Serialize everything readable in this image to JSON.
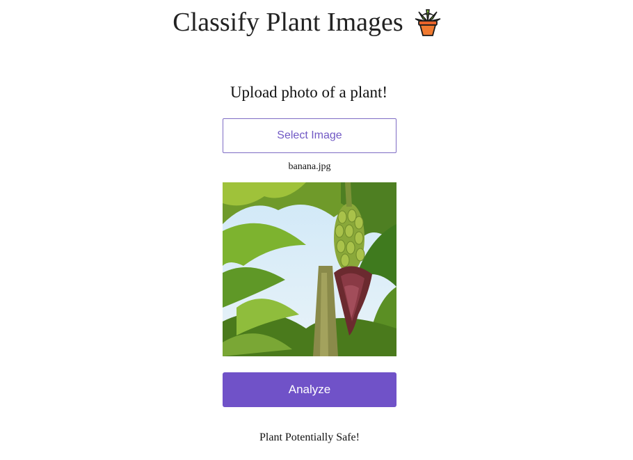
{
  "header": {
    "title": "Classify Plant Images",
    "icon": "potted-palm-icon"
  },
  "upload": {
    "prompt": "Upload photo of a plant!",
    "select_label": "Select Image",
    "file_name": "banana.jpg",
    "preview_image": "banana-plant-photo"
  },
  "actions": {
    "analyze_label": "Analyze"
  },
  "result": {
    "text": "Plant Potentially Safe!"
  },
  "colors": {
    "accent": "#7052c8",
    "accent_text": "#7058c4"
  }
}
